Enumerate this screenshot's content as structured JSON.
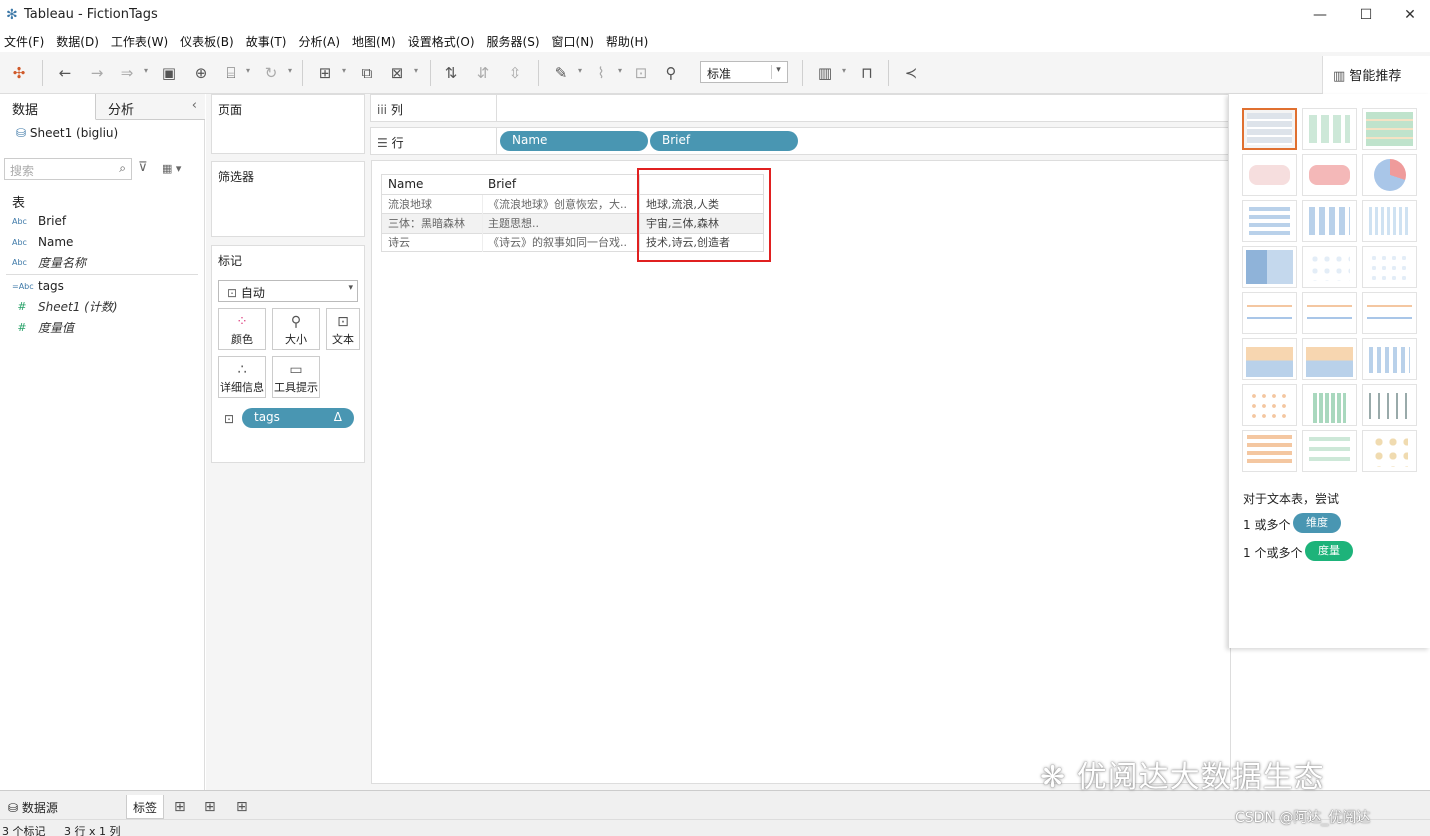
{
  "window": {
    "title": "Tableau - FictionTags"
  },
  "menu": [
    "文件(F)",
    "数据(D)",
    "工作表(W)",
    "仪表板(B)",
    "故事(T)",
    "分析(A)",
    "地图(M)",
    "设置格式(O)",
    "服务器(S)",
    "窗口(N)",
    "帮助(H)"
  ],
  "toolbar": {
    "fit_select": "标准",
    "smart_label": "智能推荐"
  },
  "left_panel": {
    "tab_data": "数据",
    "tab_analysis": "分析",
    "datasource": "Sheet1 (bigliu)",
    "search_placeholder": "搜索",
    "section_table": "表",
    "fields": [
      {
        "type": "Abc",
        "name": "Brief"
      },
      {
        "type": "Abc",
        "name": "Name"
      },
      {
        "type": "Abc",
        "name": "度量名称"
      },
      {
        "type": "=Abc",
        "name": "tags"
      },
      {
        "type": "#",
        "name": "Sheet1 (计数)"
      },
      {
        "type": "#",
        "name": "度量值"
      }
    ]
  },
  "shelves": {
    "pages_label": "页面",
    "filters_label": "筛选器",
    "marks_label": "标记",
    "marks_type": "自动",
    "mark_buttons": [
      "颜色",
      "大小",
      "文本",
      "详细信息",
      "工具提示"
    ],
    "marks_pill": "tags",
    "marks_pill_icon": "Δ"
  },
  "columns_shelf": {
    "label": "列"
  },
  "rows_shelf": {
    "label": "行",
    "pills": [
      "Name",
      "Brief"
    ]
  },
  "table": {
    "headers": [
      "Name",
      "Brief"
    ],
    "rows": [
      {
        "name": "流浪地球",
        "brief": "《流浪地球》创意恢宏，大..",
        "tags": "地球,流浪,人类"
      },
      {
        "name": "三体：黑暗森林",
        "brief": "主题思想..",
        "tags": "宇宙,三体,森林"
      },
      {
        "name": "诗云",
        "brief": "《诗云》的叙事如同一台戏..",
        "tags": "技术,诗云,创造者"
      }
    ]
  },
  "show_me": {
    "hint": "对于文本表，尝试",
    "dim_prefix": "1 或多个",
    "dim_label": "维度",
    "meas_prefix": "1 个或多个",
    "meas_label": "度量",
    "dim_color": "#4996b2",
    "meas_color": "#1db37a"
  },
  "statusbar": {
    "datasource_tab": "数据源",
    "sheet_tab": "标签",
    "marks": "3 个标记",
    "dims": "3 行 x 1 列"
  },
  "watermark": {
    "main": "优阅达大数据生态",
    "csdn": "CSDN @阿达_优阅达"
  }
}
